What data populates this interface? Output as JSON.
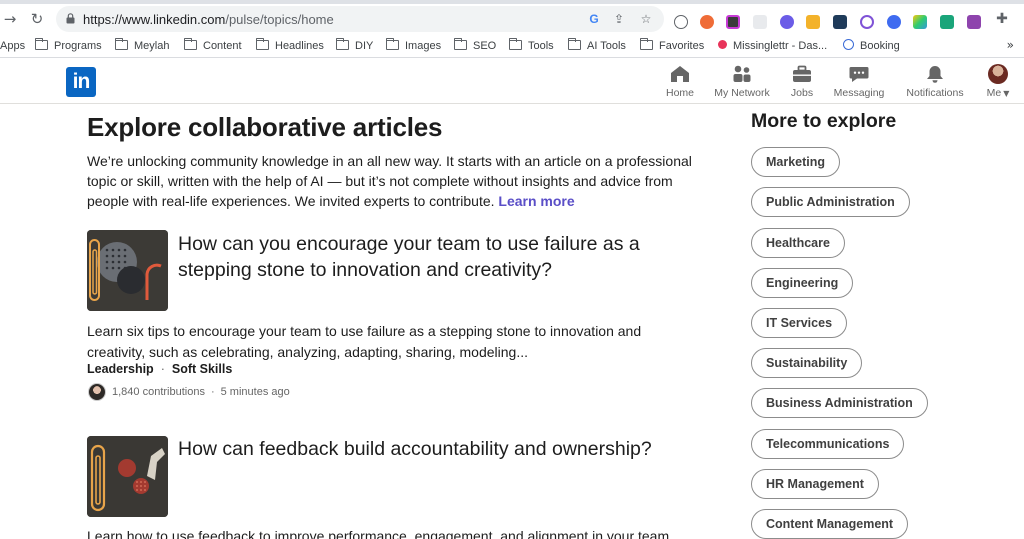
{
  "browser": {
    "url_host": "https://www.linkedin.com",
    "url_path": "/pulse/topics/home",
    "nav_back": "→",
    "nav_reload": "↻",
    "bookmarks": [
      {
        "label": "Apps"
      },
      {
        "label": "Programs"
      },
      {
        "label": "Meylah"
      },
      {
        "label": "Content"
      },
      {
        "label": "Headlines"
      },
      {
        "label": "DIY"
      },
      {
        "label": "Images"
      },
      {
        "label": "SEO"
      },
      {
        "label": "Tools"
      },
      {
        "label": "AI Tools"
      },
      {
        "label": "Favorites"
      },
      {
        "label": "Missinglettr - Das..."
      },
      {
        "label": "Booking"
      }
    ],
    "bookmarks_more": "»"
  },
  "linkedin": {
    "logo_text": "in",
    "nav": [
      {
        "label": "Home"
      },
      {
        "label": "My Network"
      },
      {
        "label": "Jobs"
      },
      {
        "label": "Messaging"
      },
      {
        "label": "Notifications"
      },
      {
        "label": "Me"
      }
    ]
  },
  "main": {
    "title": "Explore collaborative articles",
    "intro": "We’re unlocking community knowledge in an all new way. It starts with an article on a professional topic or skill, written with the help of AI — but it’s not complete without insights and advice from people with real-life experiences. We invited experts to contribute. ",
    "learn_more": "Learn more",
    "articles": [
      {
        "title": "How can you encourage your team to use failure as a stepping stone to innovation and creativity?",
        "description": "Learn six tips to encourage your team to use failure as a stepping stone to innovation and creativity, such as celebrating, analyzing, adapting, sharing, modeling...",
        "tag1": "Leadership",
        "tag_sep": "·",
        "tag2": "Soft Skills",
        "contributions": "1,840 contributions",
        "meta_sep": "·",
        "time": "5 minutes ago"
      },
      {
        "title": "How can feedback build accountability and ownership?",
        "description": "Learn how to use feedback to improve performance, engagement, and alignment in your team, and"
      }
    ]
  },
  "sidebar": {
    "title": "More to explore",
    "topics": [
      {
        "label": "Marketing"
      },
      {
        "label": "Public Administration"
      },
      {
        "label": "Healthcare"
      },
      {
        "label": "Engineering"
      },
      {
        "label": "IT Services"
      },
      {
        "label": "Sustainability"
      },
      {
        "label": "Business Administration"
      },
      {
        "label": "Telecommunications"
      },
      {
        "label": "HR Management"
      },
      {
        "label": "Content Management"
      }
    ]
  },
  "colors": {
    "linkedin_blue": "#0a66c2",
    "link_purple": "#5a4ec7",
    "pill_border": "#8c8c8c"
  }
}
